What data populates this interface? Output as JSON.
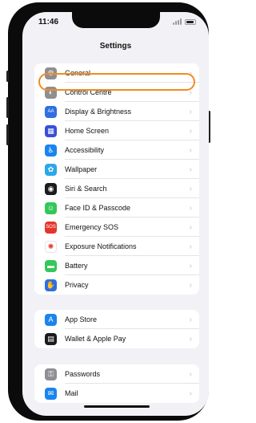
{
  "status_bar": {
    "time": "11:46"
  },
  "header": {
    "title": "Settings"
  },
  "groups": [
    {
      "items": [
        {
          "label": "General",
          "icon": "gear-icon",
          "color": "#8e8e93",
          "glyph": "⚙"
        },
        {
          "label": "Control Centre",
          "icon": "control-centre-icon",
          "color": "#8e8e93",
          "glyph": "◐"
        },
        {
          "label": "Display & Brightness",
          "icon": "display-brightness-icon",
          "color": "#2f6fe0",
          "glyph": "AA"
        },
        {
          "label": "Home Screen",
          "icon": "home-screen-icon",
          "color": "#3a4fd8",
          "glyph": "▦"
        },
        {
          "label": "Accessibility",
          "icon": "accessibility-icon",
          "color": "#1a84ef",
          "glyph": "♿"
        },
        {
          "label": "Wallpaper",
          "icon": "wallpaper-icon",
          "color": "#2aa8e8",
          "glyph": "✿"
        },
        {
          "label": "Siri & Search",
          "icon": "siri-icon",
          "color": "#1c1c1e",
          "glyph": "◉"
        },
        {
          "label": "Face ID & Passcode",
          "icon": "face-id-icon",
          "color": "#34c759",
          "glyph": "☺"
        },
        {
          "label": "Emergency SOS",
          "icon": "sos-icon",
          "color": "#e5352b",
          "glyph": "SOS"
        },
        {
          "label": "Exposure Notifications",
          "icon": "exposure-notifications-icon",
          "color": "#ffffff",
          "glyph": "✺"
        },
        {
          "label": "Battery",
          "icon": "battery-icon",
          "color": "#34c759",
          "glyph": "▬"
        },
        {
          "label": "Privacy",
          "icon": "privacy-hand-icon",
          "color": "#2f6fe0",
          "glyph": "✋"
        }
      ]
    },
    {
      "items": [
        {
          "label": "App Store",
          "icon": "app-store-icon",
          "color": "#1a84ef",
          "glyph": "A"
        },
        {
          "label": "Wallet & Apple Pay",
          "icon": "wallet-icon",
          "color": "#1c1c1e",
          "glyph": "▤"
        }
      ]
    },
    {
      "items": [
        {
          "label": "Passwords",
          "icon": "passwords-key-icon",
          "color": "#8e8e93",
          "glyph": "⚿"
        },
        {
          "label": "Mail",
          "icon": "mail-icon",
          "color": "#1a84ef",
          "glyph": "✉"
        }
      ]
    }
  ],
  "chevron": "›",
  "highlight_color": "#f28c1e"
}
